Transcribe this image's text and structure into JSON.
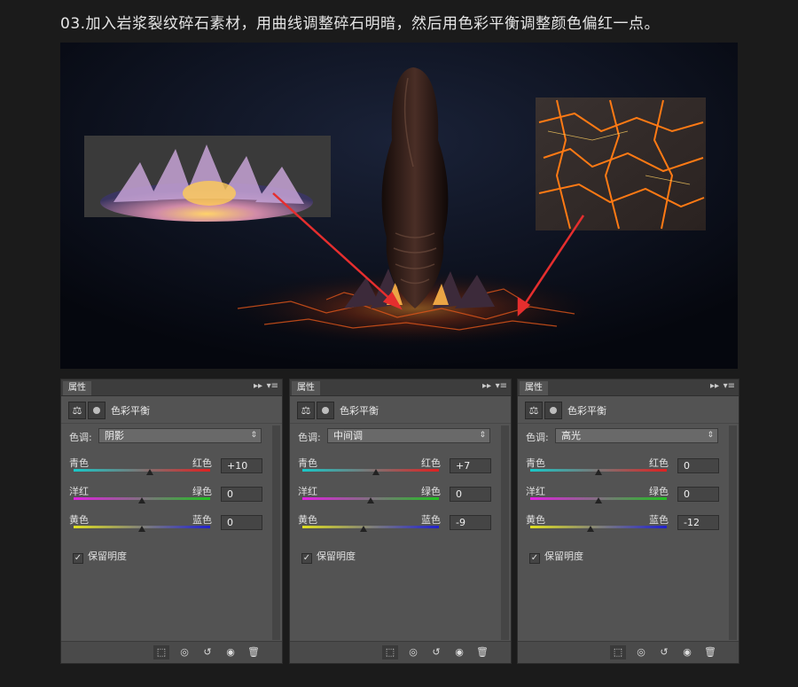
{
  "heading": "03.加入岩浆裂纹碎石素材，用曲线调整碎石明暗，然后用色彩平衡调整颜色偏红一点。",
  "panels": [
    {
      "tab": "属性",
      "title": "色彩平衡",
      "tone_label": "色调:",
      "tone": "阴影",
      "sliders": [
        {
          "left": "青色",
          "right": "红色",
          "value": "+10",
          "position": 0.56,
          "colors": [
            "#18c8c8",
            "#e02020"
          ]
        },
        {
          "left": "洋红",
          "right": "绿色",
          "value": "0",
          "position": 0.5,
          "colors": [
            "#e020e0",
            "#20c020"
          ]
        },
        {
          "left": "黄色",
          "right": "蓝色",
          "value": "0",
          "position": 0.5,
          "colors": [
            "#e0e020",
            "#2020d0"
          ]
        }
      ],
      "preserve": "保留明度"
    },
    {
      "tab": "属性",
      "title": "色彩平衡",
      "tone_label": "色调:",
      "tone": "中间调",
      "sliders": [
        {
          "left": "青色",
          "right": "红色",
          "value": "+7",
          "position": 0.54,
          "colors": [
            "#18c8c8",
            "#e02020"
          ]
        },
        {
          "left": "洋红",
          "right": "绿色",
          "value": "0",
          "position": 0.5,
          "colors": [
            "#e020e0",
            "#20c020"
          ]
        },
        {
          "left": "黄色",
          "right": "蓝色",
          "value": "-9",
          "position": 0.45,
          "colors": [
            "#e0e020",
            "#2020d0"
          ]
        }
      ],
      "preserve": "保留明度"
    },
    {
      "tab": "属性",
      "title": "色彩平衡",
      "tone_label": "色调:",
      "tone": "高光",
      "sliders": [
        {
          "left": "青色",
          "right": "红色",
          "value": "0",
          "position": 0.5,
          "colors": [
            "#18c8c8",
            "#e02020"
          ]
        },
        {
          "left": "洋红",
          "right": "绿色",
          "value": "0",
          "position": 0.5,
          "colors": [
            "#e020e0",
            "#20c020"
          ]
        },
        {
          "left": "黄色",
          "right": "蓝色",
          "value": "-12",
          "position": 0.44,
          "colors": [
            "#e0e020",
            "#2020d0"
          ]
        }
      ],
      "preserve": "保留明度"
    }
  ]
}
